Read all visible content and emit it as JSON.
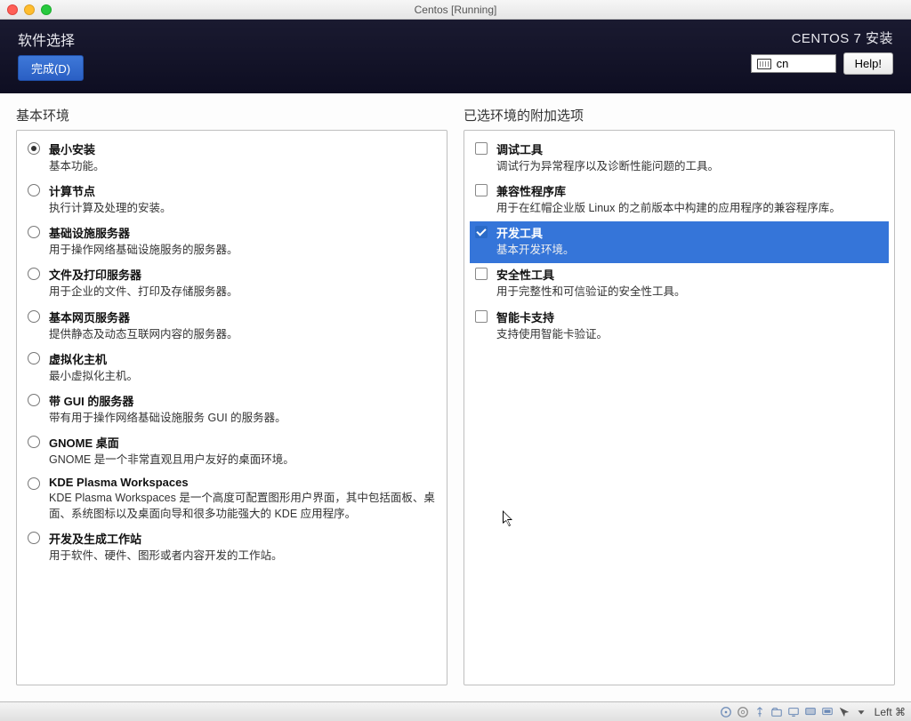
{
  "titlebar": {
    "title": "Centos [Running]"
  },
  "installer": {
    "page_title": "软件选择",
    "done_label": "完成(D)",
    "brand": "CENTOS 7 安装",
    "lang_code": "cn",
    "help_label": "Help!"
  },
  "left": {
    "header": "基本环境",
    "items": [
      {
        "id": "minimal",
        "title": "最小安装",
        "desc": "基本功能。",
        "checked": true
      },
      {
        "id": "compute-node",
        "title": "计算节点",
        "desc": "执行计算及处理的安装。",
        "checked": false
      },
      {
        "id": "infrastructure-server",
        "title": "基础设施服务器",
        "desc": "用于操作网络基础设施服务的服务器。",
        "checked": false
      },
      {
        "id": "file-print-server",
        "title": "文件及打印服务器",
        "desc": "用于企业的文件、打印及存储服务器。",
        "checked": false
      },
      {
        "id": "basic-web-server",
        "title": "基本网页服务器",
        "desc": "提供静态及动态互联网内容的服务器。",
        "checked": false
      },
      {
        "id": "virtualization-host",
        "title": "虚拟化主机",
        "desc": "最小虚拟化主机。",
        "checked": false
      },
      {
        "id": "server-with-gui",
        "title": "带 GUI 的服务器",
        "desc": "带有用于操作网络基础设施服务 GUI 的服务器。",
        "checked": false
      },
      {
        "id": "gnome-desktop",
        "title": "GNOME 桌面",
        "desc": "GNOME 是一个非常直观且用户友好的桌面环境。",
        "checked": false
      },
      {
        "id": "kde-plasma",
        "title": "KDE Plasma Workspaces",
        "desc": "KDE Plasma Workspaces 是一个高度可配置图形用户界面，其中包括面板、桌面、系统图标以及桌面向导和很多功能强大的 KDE 应用程序。",
        "checked": false
      },
      {
        "id": "dev-workstation",
        "title": "开发及生成工作站",
        "desc": "用于软件、硬件、图形或者内容开发的工作站。",
        "checked": false
      }
    ]
  },
  "right": {
    "header": "已选环境的附加选项",
    "items": [
      {
        "id": "debugging-tools",
        "title": "调试工具",
        "desc": "调试行为异常程序以及诊断性能问题的工具。",
        "checked": false
      },
      {
        "id": "compat-libs",
        "title": "兼容性程序库",
        "desc": "用于在红帽企业版 Linux 的之前版本中构建的应用程序的兼容程序库。",
        "checked": false
      },
      {
        "id": "development-tools",
        "title": "开发工具",
        "desc": "基本开发环境。",
        "checked": true
      },
      {
        "id": "security-tools",
        "title": "安全性工具",
        "desc": "用于完整性和可信验证的安全性工具。",
        "checked": false
      },
      {
        "id": "smart-card",
        "title": "智能卡支持",
        "desc": "支持使用智能卡验证。",
        "checked": false
      }
    ]
  },
  "statusbar": {
    "host_key": "Left ⌘"
  }
}
